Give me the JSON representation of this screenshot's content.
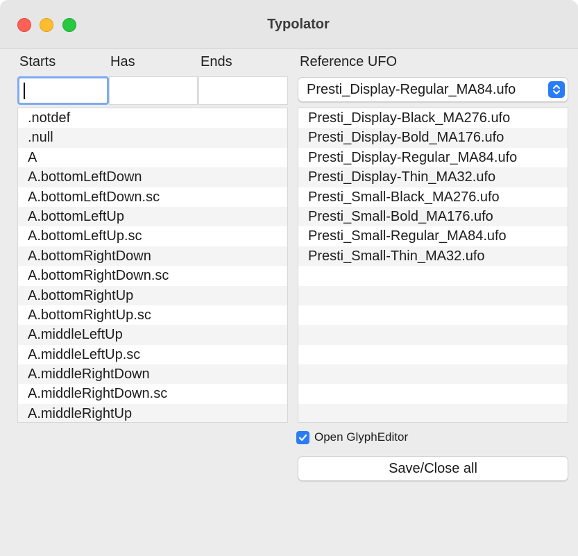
{
  "window": {
    "title": "Typolator"
  },
  "search": {
    "starts_label": "Starts",
    "has_label": "Has",
    "ends_label": "Ends",
    "starts_value": "",
    "has_value": "",
    "ends_value": ""
  },
  "reference": {
    "label": "Reference UFO",
    "selected": "Presti_Display-Regular_MA84.ufo"
  },
  "glyph_list": [
    ".notdef",
    ".null",
    "A",
    "A.bottomLeftDown",
    "A.bottomLeftDown.sc",
    "A.bottomLeftUp",
    "A.bottomLeftUp.sc",
    "A.bottomRightDown",
    "A.bottomRightDown.sc",
    "A.bottomRightUp",
    "A.bottomRightUp.sc",
    "A.middleLeftUp",
    "A.middleLeftUp.sc",
    "A.middleRightDown",
    "A.middleRightDown.sc",
    "A.middleRightUp"
  ],
  "ufo_list": [
    "Presti_Display-Black_MA276.ufo",
    "Presti_Display-Bold_MA176.ufo",
    "Presti_Display-Regular_MA84.ufo",
    "Presti_Display-Thin_MA32.ufo",
    "Presti_Small-Black_MA276.ufo",
    "Presti_Small-Bold_MA176.ufo",
    "Presti_Small-Regular_MA84.ufo",
    "Presti_Small-Thin_MA32.ufo",
    "",
    "",
    "",
    "",
    "",
    "",
    "",
    ""
  ],
  "options": {
    "open_glyph_editor_label": "Open GlyphEditor",
    "open_glyph_editor_checked": true
  },
  "actions": {
    "save_close_label": "Save/Close all"
  },
  "colors": {
    "accent": "#2a7cf6",
    "focus_ring": "#7eaaf3"
  }
}
